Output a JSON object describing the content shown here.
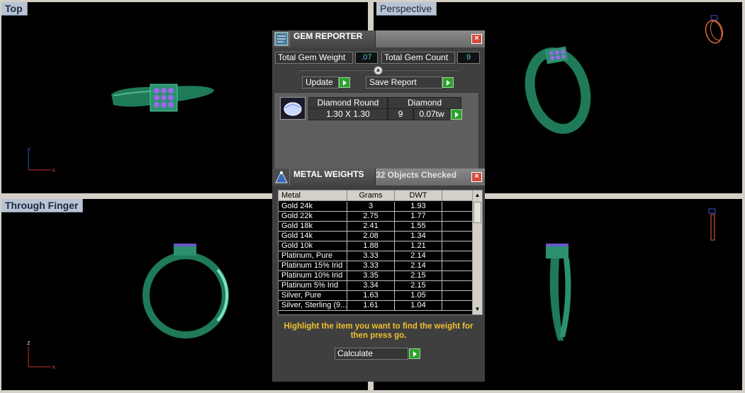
{
  "viewports": {
    "top": "Top",
    "perspective": "Perspective",
    "through_finger": "Through Finger"
  },
  "gem_reporter": {
    "title": "GEM REPORTER",
    "total_gem_weight_label": "Total Gem Weight",
    "total_gem_weight_value": ".07",
    "total_gem_count_label": "Total Gem Count",
    "total_gem_count_value": "9",
    "update_label": "Update",
    "save_report_label": "Save Report",
    "gem": {
      "shape": "Diamond Round",
      "material": "Diamond",
      "size": "1.30 X 1.30",
      "count": "9",
      "weight": "0.07tw"
    }
  },
  "metal_weights": {
    "title": "METAL WEIGHTS",
    "subtitle": "32 Objects Checked",
    "columns": [
      "Metal",
      "Grams",
      "DWT"
    ],
    "rows": [
      {
        "metal": "Gold 24k",
        "grams": "3",
        "dwt": "1.93"
      },
      {
        "metal": "Gold 22k",
        "grams": "2.75",
        "dwt": "1.77"
      },
      {
        "metal": "Gold 18k",
        "grams": "2.41",
        "dwt": "1.55"
      },
      {
        "metal": "Gold 14k",
        "grams": "2.08",
        "dwt": "1.34"
      },
      {
        "metal": "Gold 10k",
        "grams": "1.88",
        "dwt": "1.21"
      },
      {
        "metal": "Platinum, Pure",
        "grams": "3.33",
        "dwt": "2.14"
      },
      {
        "metal": "Platinum 15% Irid",
        "grams": "3.33",
        "dwt": "2.14"
      },
      {
        "metal": "Platinum 10% Irid",
        "grams": "3.35",
        "dwt": "2.15"
      },
      {
        "metal": "Platinum 5% Irid",
        "grams": "3.34",
        "dwt": "2.15"
      },
      {
        "metal": "Silver, Pure",
        "grams": "1.63",
        "dwt": "1.05"
      },
      {
        "metal": "Silver, Sterling (9...",
        "grams": "1.61",
        "dwt": "1.04"
      }
    ],
    "hint": "Highlight the item you want to find the weight for then press go.",
    "calculate_label": "Calculate"
  },
  "colors": {
    "ring": "#2a8a66",
    "gem": "#8a5ad8",
    "viewport_bg": "#000000",
    "panel_bg": "#3f3f3f",
    "hint_text": "#f0c030"
  }
}
